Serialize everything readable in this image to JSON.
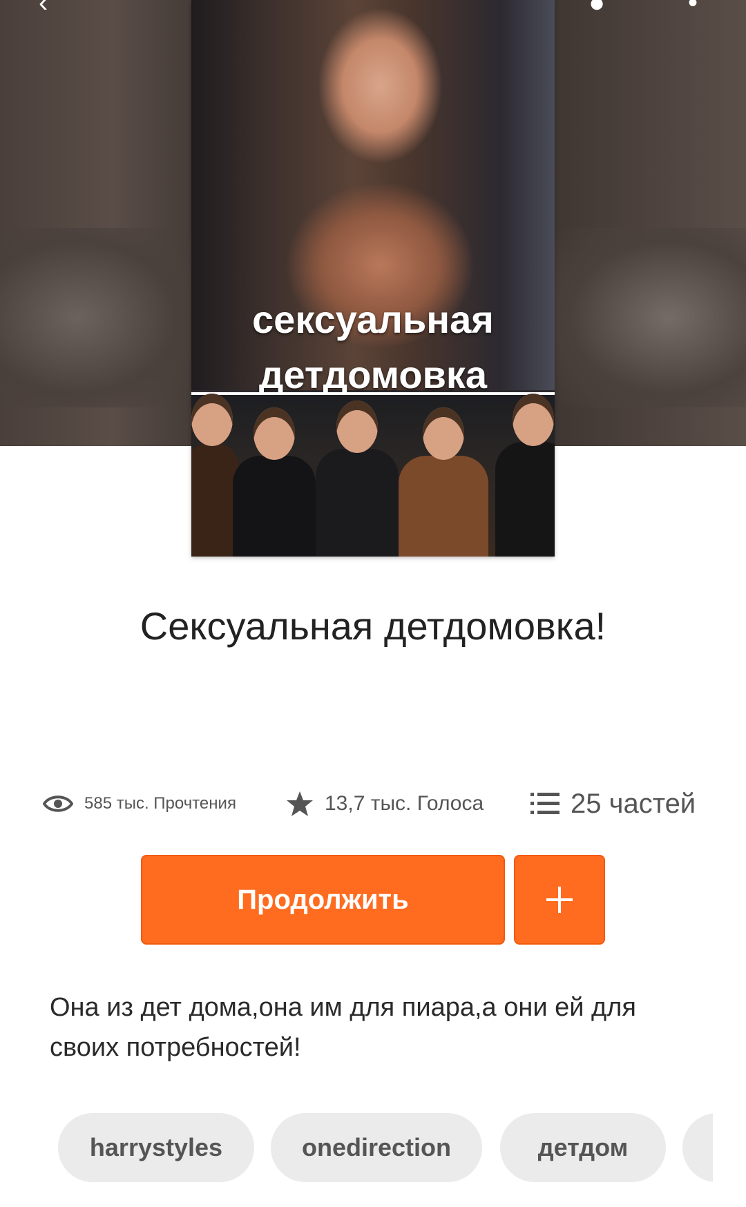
{
  "header": {
    "back_icon": "back-arrow-icon",
    "share_icon": "share-icon",
    "more_icon": "more-vert-icon"
  },
  "cover": {
    "line1": "сексуальная",
    "line2": "детдомовка"
  },
  "story": {
    "title": "Сексуальная детдомовка!",
    "description": "Она из дет дома,она им для пиара,а они ей для своих потребностей!"
  },
  "stats": {
    "reads": "585 тыс. Прочтения",
    "votes": "13,7 тыс. Голоса",
    "parts": "25 частей"
  },
  "actions": {
    "continue_label": "Продолжить",
    "add_label": "+"
  },
  "tags": [
    "harrystyles",
    "onedirection",
    "детдом"
  ],
  "colors": {
    "accent": "#ff6c1f",
    "tag_bg": "#ebebeb",
    "text": "#222222"
  }
}
